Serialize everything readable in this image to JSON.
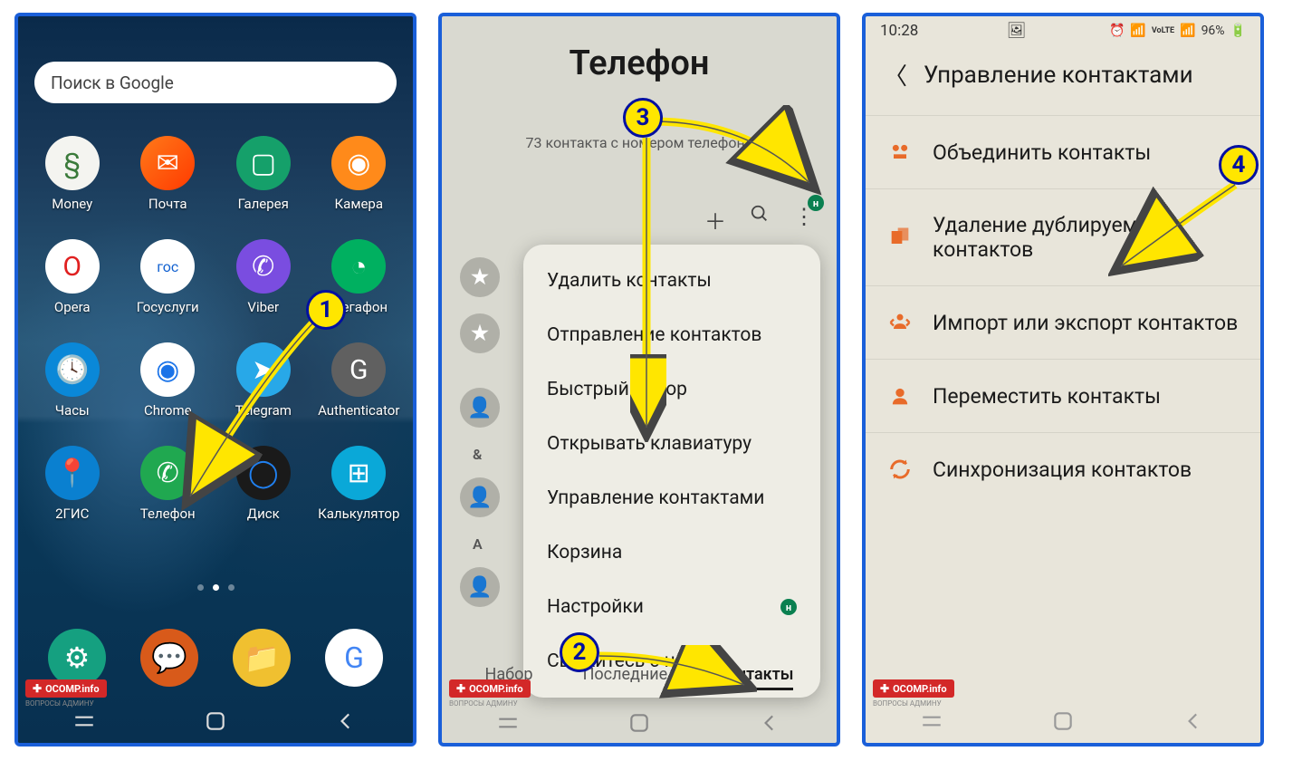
{
  "phone1": {
    "search_placeholder": "Поиск в Google",
    "apps": [
      {
        "label": "Money",
        "bg": "#f4f4f0",
        "glyph": "§",
        "fg": "#3a7a3a"
      },
      {
        "label": "Почта",
        "bg": "linear-gradient(135deg,#ff7a1a,#ff3a00)",
        "glyph": "✉",
        "fg": "#fff"
      },
      {
        "label": "Галерея",
        "bg": "#15a06a",
        "glyph": "▢",
        "fg": "#fff"
      },
      {
        "label": "Камера",
        "bg": "#ff8a1a",
        "glyph": "◉",
        "fg": "#fff"
      },
      {
        "label": "Opera",
        "bg": "#fff",
        "glyph": "O",
        "fg": "#e02020"
      },
      {
        "label": "Госуслуги",
        "bg": "#fff",
        "glyph": "гос",
        "fg": "#1060d0"
      },
      {
        "label": "Viber",
        "bg": "#7a4de0",
        "glyph": "✆",
        "fg": "#fff"
      },
      {
        "label": "Мегафон",
        "bg": "#00b060",
        "glyph": "◔",
        "fg": "#fff"
      },
      {
        "label": "Часы",
        "bg": "#0a88d8",
        "glyph": "🕓",
        "fg": "#fff"
      },
      {
        "label": "Chrome",
        "bg": "#fff",
        "glyph": "◉",
        "fg": "#1a73e8"
      },
      {
        "label": "Telegram",
        "bg": "#28a8e8",
        "glyph": "➤",
        "fg": "#fff"
      },
      {
        "label": "Authenticator",
        "bg": "#606060",
        "glyph": "G",
        "fg": "#fff"
      },
      {
        "label": "2ГИС",
        "bg": "#0a80d0",
        "glyph": "📍",
        "fg": "#fff"
      },
      {
        "label": "Телефон",
        "bg": "#20a850",
        "glyph": "✆",
        "fg": "#fff"
      },
      {
        "label": "Диск",
        "bg": "#1a1a1a",
        "glyph": "◯",
        "fg": "#2080f0"
      },
      {
        "label": "Калькулятор",
        "bg": "#0aa8d8",
        "glyph": "⊞",
        "fg": "#fff"
      }
    ],
    "dock": [
      {
        "name": "settings",
        "bg": "#15a080",
        "glyph": "⚙"
      },
      {
        "name": "messages",
        "bg": "#d85a1a",
        "glyph": "💬"
      },
      {
        "name": "files",
        "bg": "#f0c030",
        "glyph": "📁"
      },
      {
        "name": "google",
        "bg": "#fff",
        "glyph": "G"
      }
    ]
  },
  "phone2": {
    "title": "Телефон",
    "subtitle": "73 контакта с номером телефона",
    "search_icon": "search",
    "menu": [
      "Удалить контакты",
      "Отправление контактов",
      "Быстрый набор",
      "Открывать клавиатуру",
      "Управление контактами",
      "Корзина",
      "Настройки",
      "Свяжитесь с нами"
    ],
    "letter1": "&",
    "letter2": "А",
    "settings_badge": "н",
    "tabs": [
      "Набор",
      "Последние",
      "Контакты"
    ],
    "active_tab": 2
  },
  "phone3": {
    "status_time": "10:28",
    "status_battery": "96%",
    "header": "Управление контактами",
    "items": [
      {
        "icon": "merge",
        "label": "Объединить контакты"
      },
      {
        "icon": "dup",
        "label": "Удаление дублируемых контактов"
      },
      {
        "icon": "impexp",
        "label": "Импорт или экспорт контактов"
      },
      {
        "icon": "move",
        "label": "Переместить контакты"
      },
      {
        "icon": "sync",
        "label": "Синхронизация контактов"
      }
    ]
  },
  "watermark": "OCOMP.info",
  "watermark_sub": "ВОПРОСЫ АДМИНУ",
  "bubbles": {
    "b1": "1",
    "b2": "2",
    "b3": "3",
    "b4": "4"
  }
}
